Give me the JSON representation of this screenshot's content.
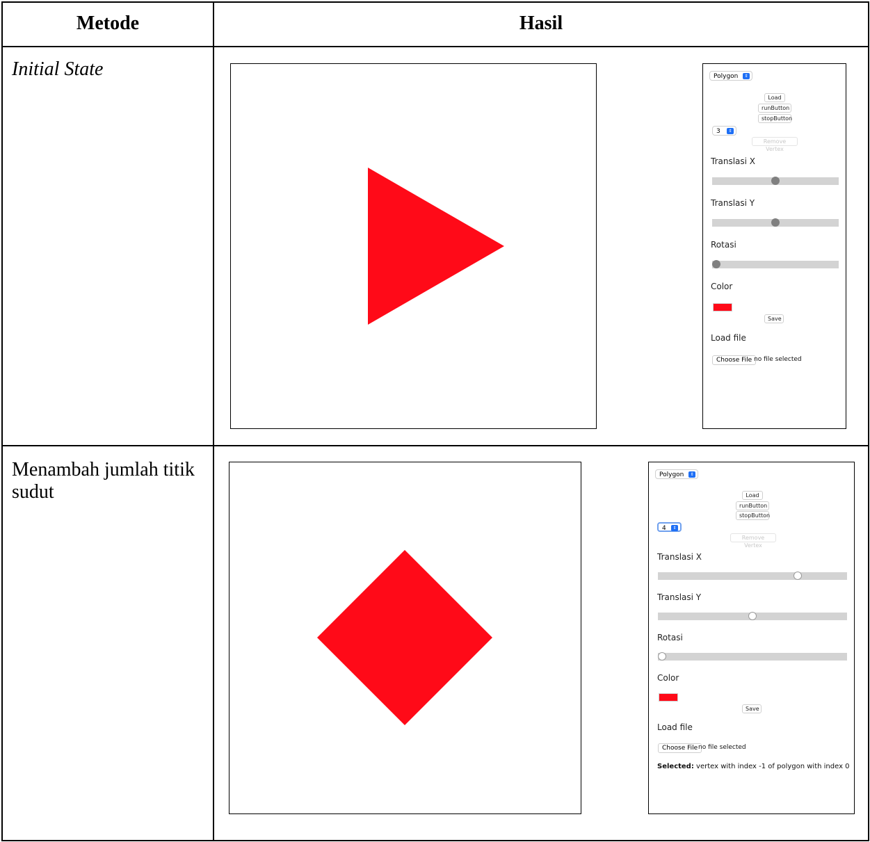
{
  "table": {
    "header_method": "Metode",
    "header_result": "Hasil"
  },
  "rows": [
    {
      "method": "Initial State",
      "shape": "triangle",
      "shape_color": "#ff0a18",
      "panel": {
        "shape_select": "Polygon",
        "load": "Load",
        "run": "runButton",
        "stop": "stopButton",
        "vertex_count": "3",
        "remove_vertex": "Remove Vertex",
        "translasi_x": "Translasi X",
        "translasi_y": "Translasi Y",
        "rotasi": "Rotasi",
        "color": "Color",
        "save": "Save",
        "load_file": "Load file",
        "choose_file": "Choose File",
        "no_file": "no file selected"
      }
    },
    {
      "method": "Menambah jumlah titik sudut",
      "shape": "diamond",
      "shape_color": "#ff0a18",
      "panel": {
        "shape_select": "Polygon",
        "load": "Load",
        "run": "runButton",
        "stop": "stopButton",
        "vertex_count": "4",
        "remove_vertex": "Remove Vertex",
        "translasi_x": "Translasi X",
        "translasi_y": "Translasi Y",
        "rotasi": "Rotasi",
        "color": "Color",
        "save": "Save",
        "load_file": "Load file",
        "choose_file": "Choose File",
        "no_file": "no file selected",
        "selected_label": "Selected:",
        "selected_text": "vertex with index -1 of polygon with index 0"
      }
    }
  ]
}
